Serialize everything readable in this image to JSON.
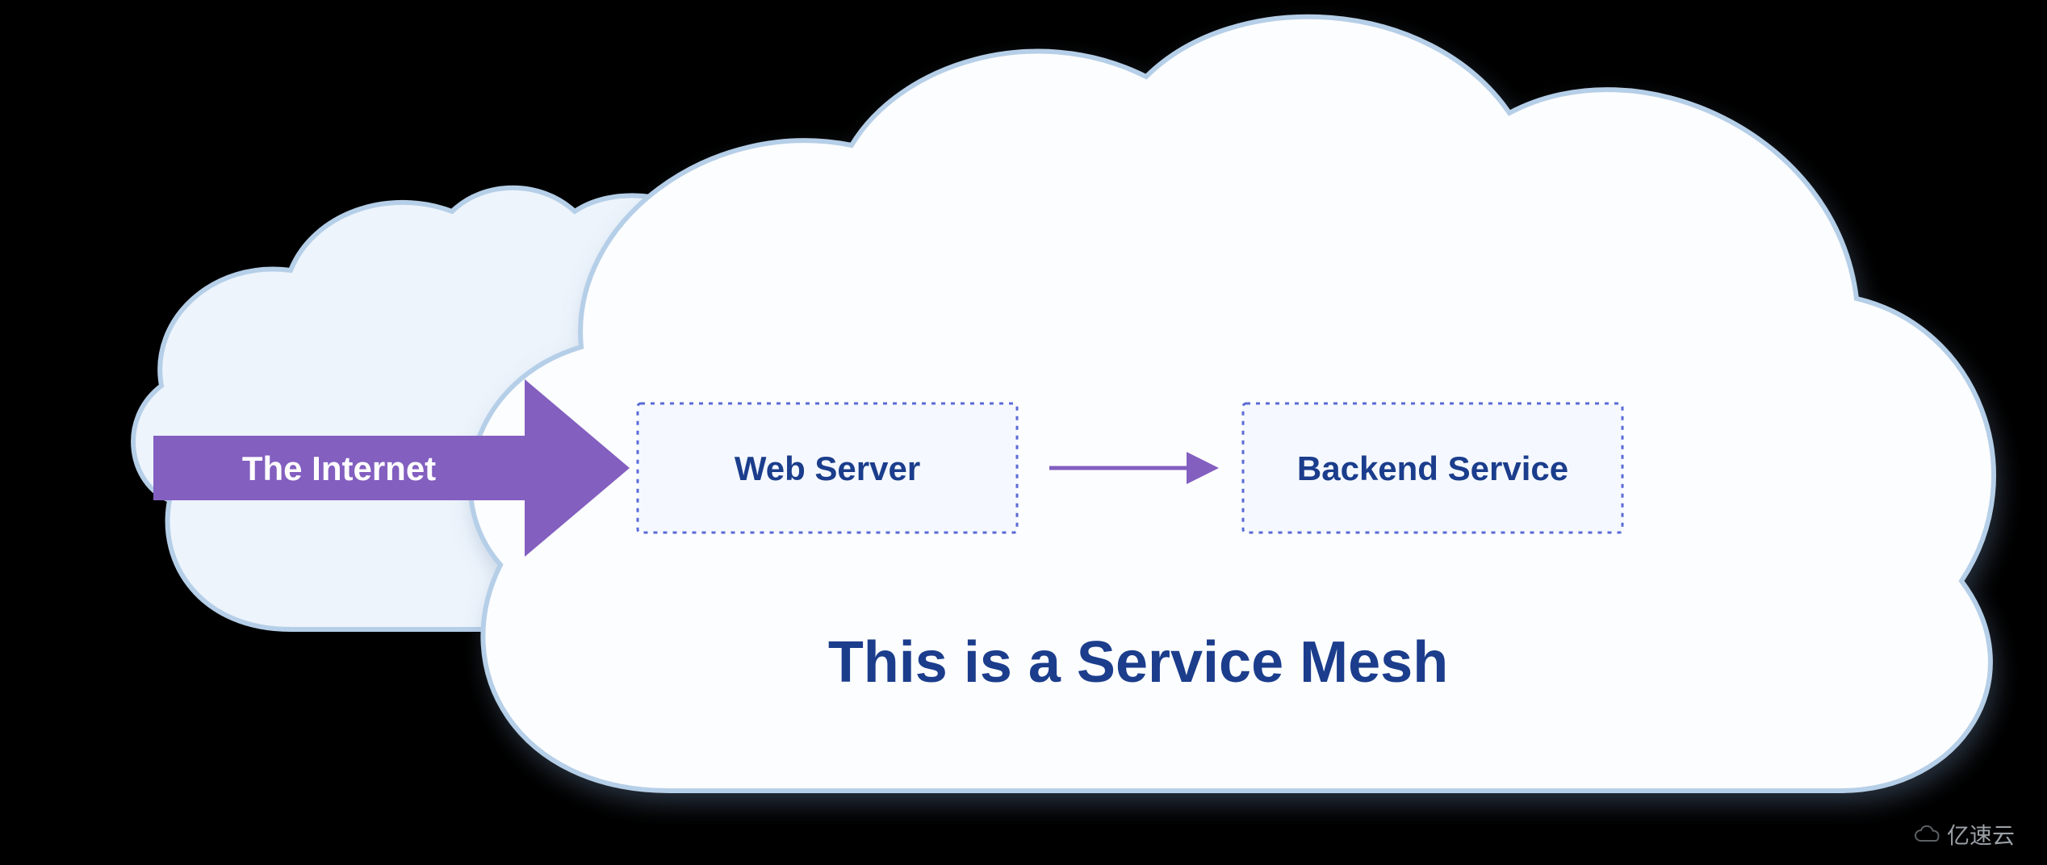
{
  "diagram": {
    "internet_label": "The Internet",
    "web_server_label": "Web Server",
    "backend_service_label": "Backend Service",
    "caption": "This is a Service Mesh"
  },
  "watermark": "亿速云",
  "colors": {
    "cloud_back_fill": "#edf4fc",
    "cloud_back_stroke": "#b6cfe8",
    "cloud_front_fill": "#fcfdff",
    "cloud_front_stroke": "#b6cfe8",
    "arrow_fill": "#835fc0",
    "box_stroke": "#5a6bd6",
    "box_fill": "#f5f9ff",
    "text_primary": "#1b3d8c"
  }
}
